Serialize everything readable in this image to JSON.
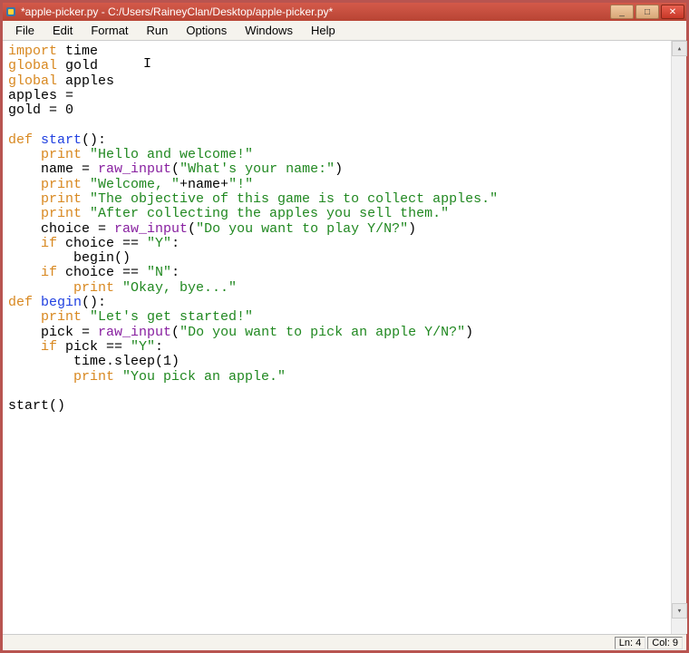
{
  "title": "*apple-picker.py - C:/Users/RaineyClan/Desktop/apple-picker.py*",
  "menu": {
    "file": "File",
    "edit": "Edit",
    "format": "Format",
    "run": "Run",
    "options": "Options",
    "windows": "Windows",
    "help": "Help"
  },
  "code": {
    "l1_kw": "import",
    "l1_rest": " time",
    "l2_kw": "global",
    "l2_rest": " gold",
    "l3_kw": "global",
    "l3_rest": " apples",
    "l4": "apples =",
    "l5": "gold = 0",
    "l6_kw": "def",
    "l6_fn": " start",
    "l6_rest": "():",
    "l7_kw": "    print",
    "l7_str": " \"Hello and welcome!\"",
    "l8_a": "    name = ",
    "l8_fn": "raw_input",
    "l8_b": "(",
    "l8_str": "\"What's your name:\"",
    "l8_c": ")",
    "l9_kw": "    print",
    "l9_str": " \"Welcome, \"",
    "l9_b": "+name+",
    "l9_str2": "\"!\"",
    "l10_kw": "    print",
    "l10_str": " \"The objective of this game is to collect apples.\"",
    "l11_kw": "    print",
    "l11_str": " \"After collecting the apples you sell them.\"",
    "l12_a": "    choice = ",
    "l12_fn": "raw_input",
    "l12_b": "(",
    "l12_str": "\"Do you want to play Y/N?\"",
    "l12_c": ")",
    "l13_kw": "    if",
    "l13_rest": " choice == ",
    "l13_str": "\"Y\"",
    "l13_c": ":",
    "l14": "        begin()",
    "l15_kw": "    if",
    "l15_rest": " choice == ",
    "l15_str": "\"N\"",
    "l15_c": ":",
    "l16_kw": "        print",
    "l16_str": " \"Okay, bye...\"",
    "l17_kw": "def",
    "l17_fn": " begin",
    "l17_rest": "():",
    "l18_kw": "    print",
    "l18_str": " \"Let's get started!\"",
    "l19_a": "    pick = ",
    "l19_fn": "raw_input",
    "l19_b": "(",
    "l19_str": "\"Do you want to pick an apple Y/N?\"",
    "l19_c": ")",
    "l20_kw": "    if",
    "l20_rest": " pick == ",
    "l20_str": "\"Y\"",
    "l20_c": ":",
    "l21": "        time.sleep(1)",
    "l22_kw": "        print",
    "l22_str": " \"You pick an apple.\"",
    "l23": "start()"
  },
  "status": {
    "line": "Ln: 4",
    "col": "Col: 9"
  },
  "win_controls": {
    "min": "_",
    "max": "□",
    "close": "✕"
  }
}
